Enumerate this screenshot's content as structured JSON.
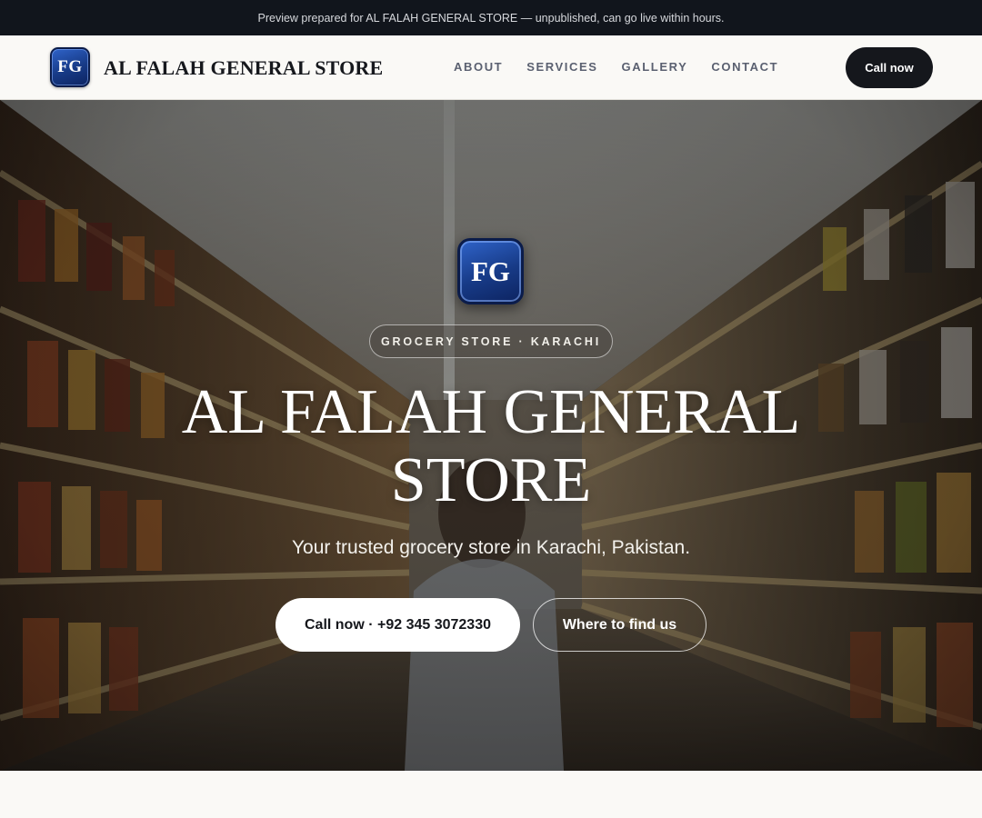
{
  "banner": {
    "text": "Preview prepared for AL FALAH GENERAL STORE — unpublished, can go live within hours."
  },
  "header": {
    "logo_initials": "FG",
    "brand_name": "AL FALAH GENERAL STORE",
    "nav": [
      {
        "label": "ABOUT"
      },
      {
        "label": "SERVICES"
      },
      {
        "label": "GALLERY"
      },
      {
        "label": "CONTACT"
      }
    ],
    "cta_label": "Call now"
  },
  "hero": {
    "logo_initials": "FG",
    "tag": "GROCERY STORE · KARACHI",
    "title": "AL FALAH GENERAL STORE",
    "subtitle": "Your trusted grocery store in Karachi, Pakistan.",
    "primary_button": "Call now · +92 345 3072330",
    "secondary_button": "Where to find us",
    "background_image": "grocery-aisle-photo"
  },
  "colors": {
    "topbar_bg": "#11151c",
    "nav_bg": "#faf9f6",
    "accent_dark": "#15171c",
    "logo_blue": "#173a86"
  }
}
